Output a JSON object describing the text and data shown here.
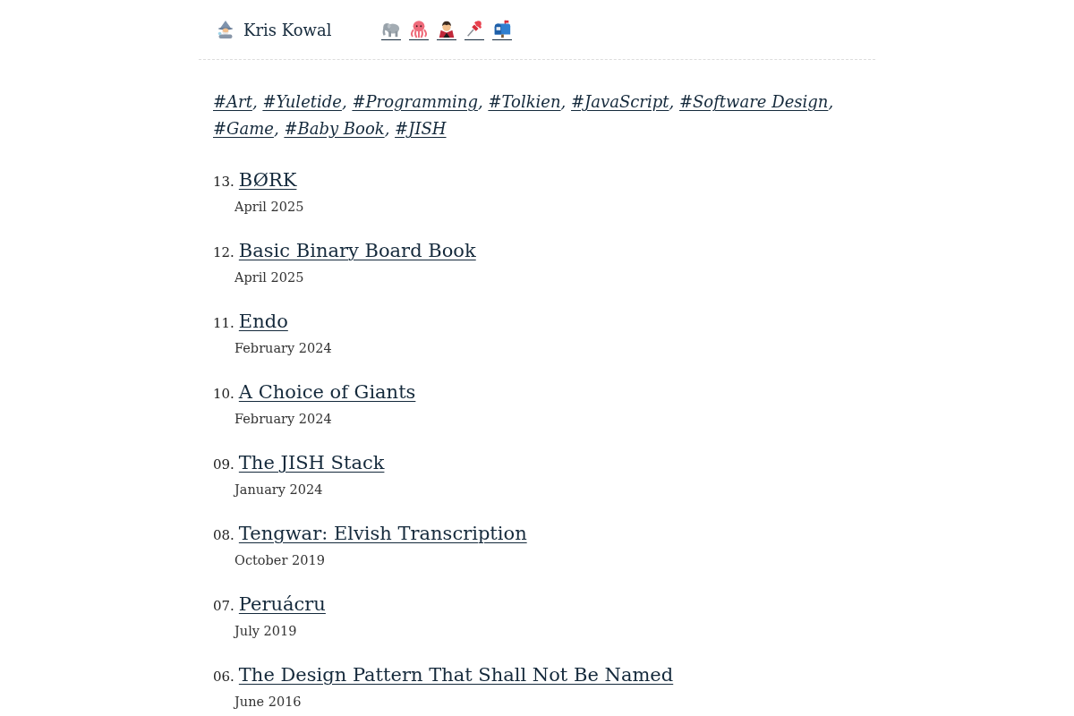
{
  "header": {
    "author": "Kris Kowal"
  },
  "tags": {
    "items": [
      "#Art",
      "#Yuletide",
      "#Programming",
      "#Tolkien",
      "#JavaScript",
      "#Software Design",
      "#Game",
      "#Baby Book",
      "#JISH"
    ],
    "separator": ","
  },
  "articles": [
    {
      "number": "13.",
      "title": "BØRK",
      "date": "April 2025"
    },
    {
      "number": "12.",
      "title": "Basic Binary Board Book",
      "date": "April 2025"
    },
    {
      "number": "11.",
      "title": "Endo",
      "date": "February 2024"
    },
    {
      "number": "10.",
      "title": "A Choice of Giants",
      "date": "February 2024"
    },
    {
      "number": "09.",
      "title": "The JISH Stack",
      "date": "January 2024"
    },
    {
      "number": "08.",
      "title": "Tengwar: Elvish Transcription",
      "date": "October 2019"
    },
    {
      "number": "07.",
      "title": "Peruácru",
      "date": "July 2019"
    },
    {
      "number": "06.",
      "title": "The Design Pattern That Shall Not Be Named",
      "date": "June 2016"
    }
  ]
}
